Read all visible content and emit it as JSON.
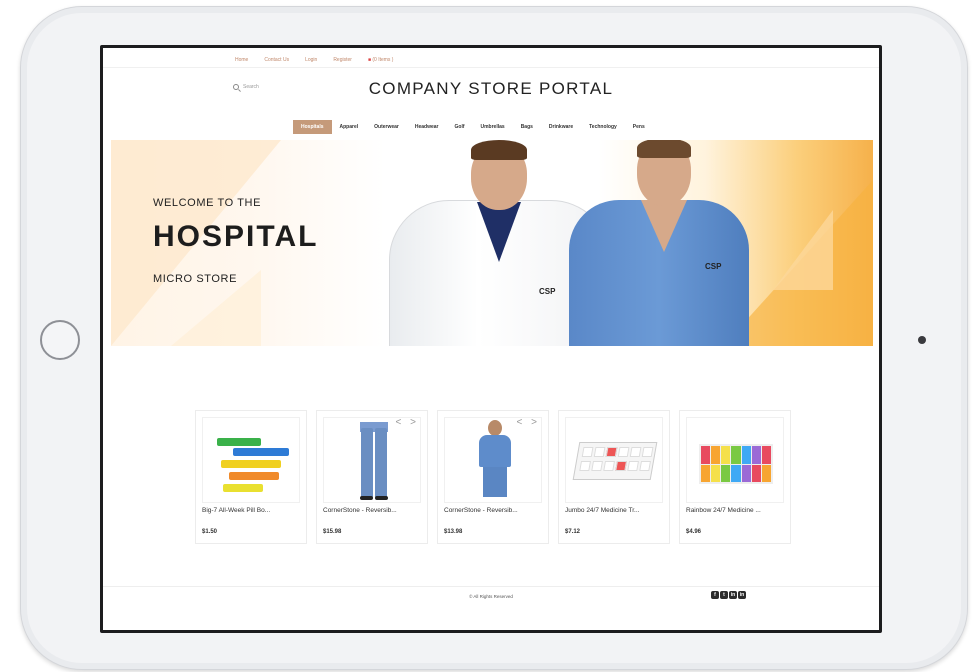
{
  "topnav": {
    "home": "Home",
    "contact": "Contact Us",
    "login": "Login",
    "register": "Register",
    "cart": "(0 Items )"
  },
  "search": {
    "placeholder": "Search"
  },
  "logo": {
    "text": "COMPANY STORE PORTAL"
  },
  "categories": [
    "Hospitals",
    "Apparel",
    "Outerwear",
    "Headwear",
    "Golf",
    "Umbrellas",
    "Bags",
    "Drinkware",
    "Technology",
    "Pens"
  ],
  "active_category_index": 0,
  "hero": {
    "line1": "WELCOME TO THE",
    "line2": "HOSPITAL",
    "line3": "MICRO STORE",
    "badge1": "CSP",
    "badge2": "CSP"
  },
  "products": [
    {
      "name": "Big-7 All-Week Pill Bo...",
      "price": "$1.50"
    },
    {
      "name": "CornerStone - Reversib...",
      "price": "$15.98"
    },
    {
      "name": "CornerStone - Reversib...",
      "price": "$13.98"
    },
    {
      "name": "Jumbo 24/7 Medicine Tr...",
      "price": "$7.12"
    },
    {
      "name": "Rainbow 24/7 Medicine ...",
      "price": "$4.96"
    }
  ],
  "carousel_arrows": "< >",
  "footer": {
    "copyright": "© All Rights Reserved"
  },
  "social": [
    "f",
    "t",
    "in",
    "in"
  ],
  "colors": {
    "accent": "#c59a7a",
    "nav_link": "#c0876a"
  }
}
